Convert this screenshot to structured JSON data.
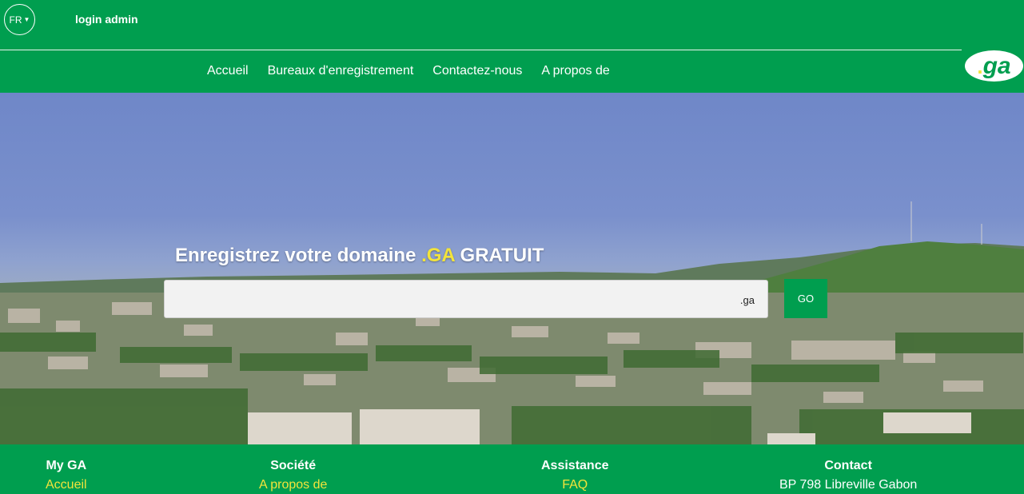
{
  "header": {
    "lang": "FR",
    "login": "login admin"
  },
  "nav": {
    "items": [
      "Accueil",
      "Bureaux d'enregistrement",
      "Contactez-nous",
      "A propos de"
    ]
  },
  "logo": {
    "dot": ".",
    "text": "ga"
  },
  "hero": {
    "headline_prefix": "Enregistrez votre domaine ",
    "headline_accent": ".GA",
    "headline_suffix": " GRATUIT",
    "search_value": "",
    "search_suffix": ".ga",
    "go_label": "GO"
  },
  "footer": {
    "columns": [
      {
        "heading": "My GA",
        "link": "Accueil"
      },
      {
        "heading": "Société",
        "link": "A propos de"
      },
      {
        "heading": "Assistance",
        "link": "FAQ"
      },
      {
        "heading": "Contact",
        "text": "BP 798 Libreville Gabon"
      }
    ]
  },
  "colors": {
    "brand_green": "#009e4f",
    "accent_yellow": "#f3e43b"
  }
}
